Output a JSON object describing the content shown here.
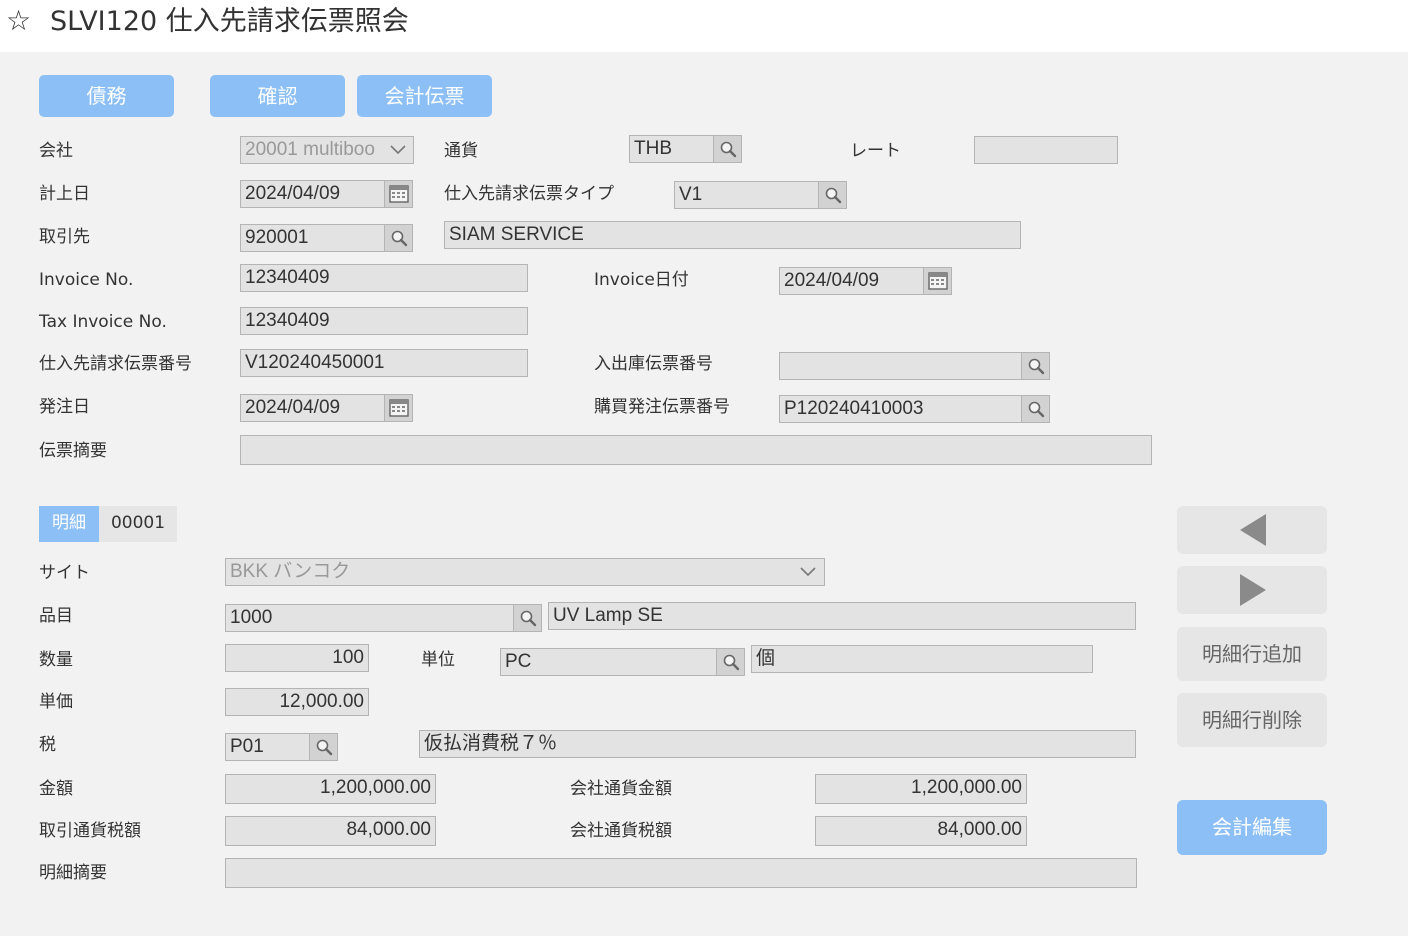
{
  "header": {
    "title": "SLVI120 仕入先請求伝票照会",
    "favorite_icon": "star-outline-icon"
  },
  "toolbar": {
    "debt": "債務",
    "confirm": "確認",
    "accounting_voucher": "会計伝票"
  },
  "form": {
    "company_label": "会社",
    "company_value": "20001 multiboo",
    "currency_label": "通貨",
    "currency_value": "THB",
    "rate_label": "レート",
    "rate_value": "",
    "posting_date_label": "計上日",
    "posting_date_value": "2024/04/09",
    "invoice_type_label": "仕入先請求伝票タイプ",
    "invoice_type_value": "V1",
    "partner_label": "取引先",
    "partner_code": "920001",
    "partner_name": "SIAM SERVICE",
    "invoice_no_label": "Invoice No.",
    "invoice_no_value": "12340409",
    "invoice_date_label": "Invoice日付",
    "invoice_date_value": "2024/04/09",
    "tax_invoice_no_label": "Tax Invoice No.",
    "tax_invoice_no_value": "12340409",
    "vendor_invoice_no_label": "仕入先請求伝票番号",
    "vendor_invoice_no_value": "V120240450001",
    "stock_slip_no_label": "入出庫伝票番号",
    "stock_slip_no_value": "",
    "order_date_label": "発注日",
    "order_date_value": "2024/04/09",
    "po_no_label": "購買発注伝票番号",
    "po_no_value": "P120240410003",
    "memo_label": "伝票摘要",
    "memo_value": ""
  },
  "detail": {
    "tab_label": "明細",
    "line_no": "00001",
    "site_label": "サイト",
    "site_value": "BKK バンコク",
    "item_label": "品目",
    "item_code": "1000",
    "item_name": "UV Lamp SE",
    "qty_label": "数量",
    "qty_value": "100",
    "unit_label": "単位",
    "unit_code": "PC",
    "unit_name": "個",
    "price_label": "単価",
    "price_value": "12,000.00",
    "tax_label": "税",
    "tax_code": "P01",
    "tax_name": "仮払消費税７％",
    "amount_label": "金額",
    "amount_value": "1,200,000.00",
    "co_amount_label": "会社通貨金額",
    "co_amount_value": "1,200,000.00",
    "tx_tax_label": "取引通貨税額",
    "tx_tax_value": "84,000.00",
    "co_tax_label": "会社通貨税額",
    "co_tax_value": "84,000.00",
    "line_memo_label": "明細摘要",
    "line_memo_value": ""
  },
  "side": {
    "prev_icon": "triangle-left-icon",
    "next_icon": "triangle-right-icon",
    "add_line": "明細行追加",
    "delete_line": "明細行削除",
    "accounting_edit": "会計編集"
  }
}
